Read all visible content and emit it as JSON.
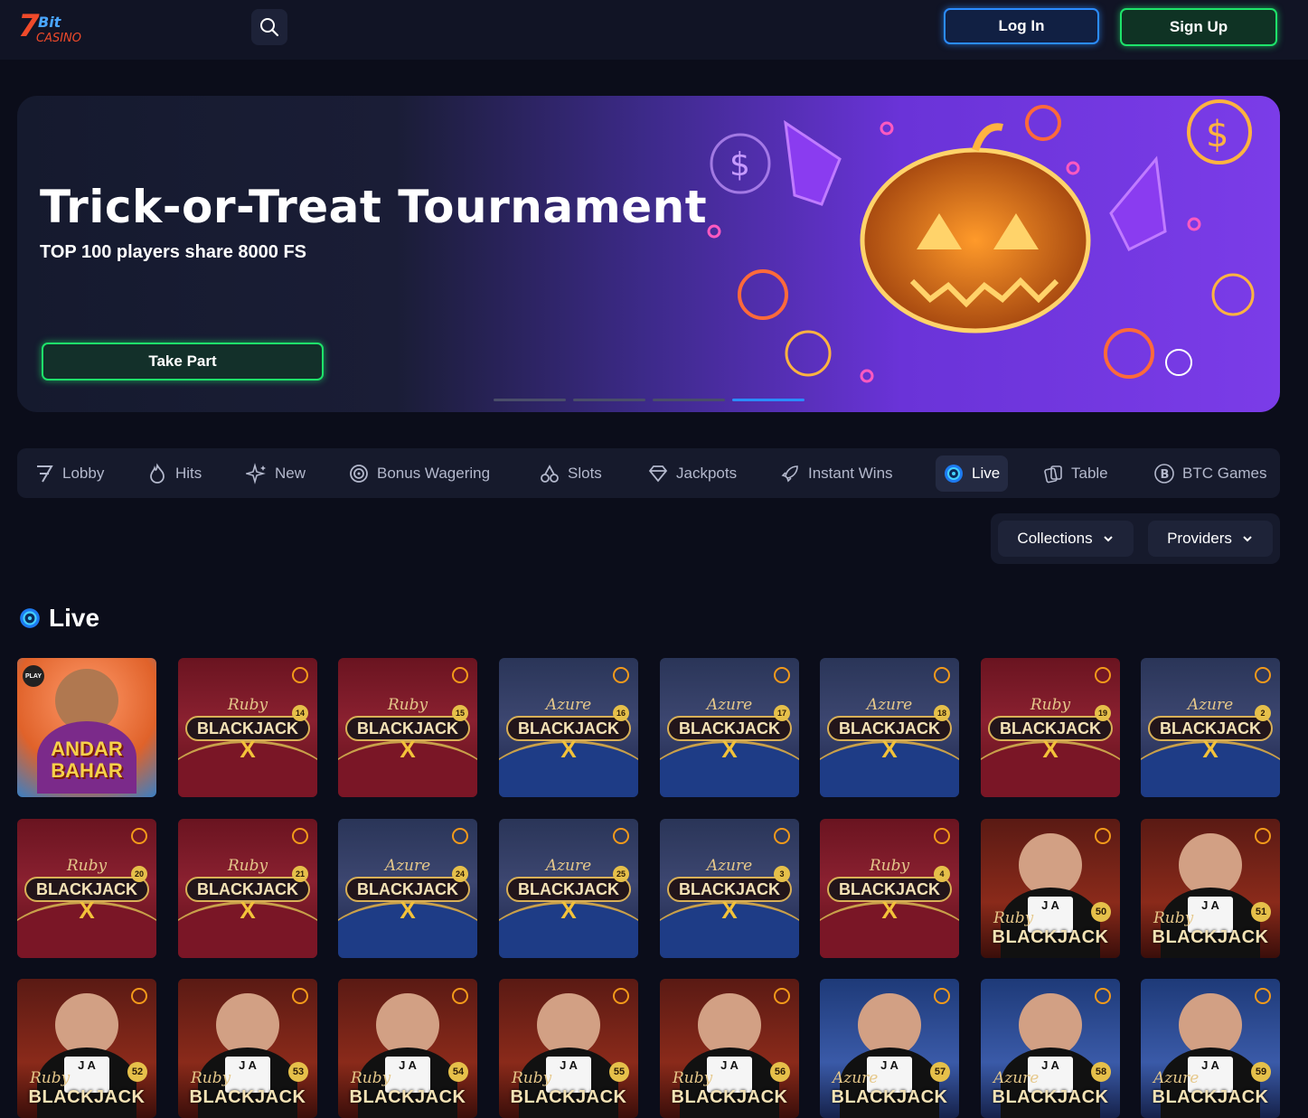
{
  "header": {
    "logo_alt": "7Bit Casino",
    "login_label": "Log In",
    "signup_label": "Sign Up"
  },
  "banner": {
    "title": "Trick-or-Treat Tournament",
    "subtitle": "TOP 100 players share 8000 FS",
    "cta_label": "Take Part",
    "slides": 4,
    "active_slide": 4
  },
  "nav": {
    "items": [
      {
        "label": "Lobby",
        "icon": "seven-icon"
      },
      {
        "label": "Hits",
        "icon": "flame-icon"
      },
      {
        "label": "New",
        "icon": "sparkle-icon"
      },
      {
        "label": "Bonus Wagering",
        "icon": "target-icon"
      },
      {
        "label": "Slots",
        "icon": "cherries-icon"
      },
      {
        "label": "Jackpots",
        "icon": "diamond-icon"
      },
      {
        "label": "Instant Wins",
        "icon": "rocket-icon"
      },
      {
        "label": "Live",
        "icon": "live-chip-icon"
      },
      {
        "label": "Table",
        "icon": "cards-icon"
      },
      {
        "label": "BTC Games",
        "icon": "bitcoin-icon"
      }
    ],
    "active": "Live"
  },
  "filters": {
    "collections_label": "Collections",
    "providers_label": "Providers"
  },
  "section": {
    "title": "Live"
  },
  "games": [
    {
      "kind": "andar",
      "line1": "ANDAR",
      "line2": "BAHAR",
      "badge": "PLAY"
    },
    {
      "kind": "table",
      "theme": "ruby",
      "brand": "Ruby",
      "name": "BLACKJACK",
      "num": "14"
    },
    {
      "kind": "table",
      "theme": "ruby",
      "brand": "Ruby",
      "name": "BLACKJACK",
      "num": "15"
    },
    {
      "kind": "table",
      "theme": "azure",
      "brand": "Azure",
      "name": "BLACKJACK",
      "num": "16"
    },
    {
      "kind": "table",
      "theme": "azure",
      "brand": "Azure",
      "name": "BLACKJACK",
      "num": "17"
    },
    {
      "kind": "table",
      "theme": "azure",
      "brand": "Azure",
      "name": "BLACKJACK",
      "num": "18"
    },
    {
      "kind": "table",
      "theme": "ruby",
      "brand": "Ruby",
      "name": "BLACKJACK",
      "num": "19"
    },
    {
      "kind": "table",
      "theme": "azure",
      "brand": "Azure",
      "name": "BLACKJACK",
      "num": "2"
    },
    {
      "kind": "table",
      "theme": "ruby",
      "brand": "Ruby",
      "name": "BLACKJACK",
      "num": "20"
    },
    {
      "kind": "table",
      "theme": "ruby",
      "brand": "Ruby",
      "name": "BLACKJACK",
      "num": "21"
    },
    {
      "kind": "table",
      "theme": "azure",
      "brand": "Azure",
      "name": "BLACKJACK",
      "num": "24"
    },
    {
      "kind": "table",
      "theme": "azure",
      "brand": "Azure",
      "name": "BLACKJACK",
      "num": "25"
    },
    {
      "kind": "table",
      "theme": "azure",
      "brand": "Azure",
      "name": "BLACKJACK",
      "num": "3"
    },
    {
      "kind": "table",
      "theme": "ruby",
      "brand": "Ruby",
      "name": "BLACKJACK",
      "num": "4"
    },
    {
      "kind": "dealer",
      "theme": "ruby",
      "brand": "Ruby",
      "name": "BLACKJACK",
      "num": "50"
    },
    {
      "kind": "dealer",
      "theme": "ruby",
      "brand": "Ruby",
      "name": "BLACKJACK",
      "num": "51"
    },
    {
      "kind": "dealer",
      "theme": "ruby",
      "brand": "Ruby",
      "name": "BLACKJACK",
      "num": "52"
    },
    {
      "kind": "dealer",
      "theme": "ruby",
      "brand": "Ruby",
      "name": "BLACKJACK",
      "num": "53"
    },
    {
      "kind": "dealer",
      "theme": "ruby",
      "brand": "Ruby",
      "name": "BLACKJACK",
      "num": "54"
    },
    {
      "kind": "dealer",
      "theme": "ruby",
      "brand": "Ruby",
      "name": "BLACKJACK",
      "num": "55"
    },
    {
      "kind": "dealer",
      "theme": "ruby",
      "brand": "Ruby",
      "name": "BLACKJACK",
      "num": "56"
    },
    {
      "kind": "dealer",
      "theme": "azure",
      "brand": "Azure",
      "name": "BLACKJACK",
      "num": "57"
    },
    {
      "kind": "dealer",
      "theme": "azure",
      "brand": "Azure",
      "name": "BLACKJACK",
      "num": "58"
    },
    {
      "kind": "dealer",
      "theme": "azure",
      "brand": "Azure",
      "name": "BLACKJACK",
      "num": "59"
    }
  ],
  "colors": {
    "accent_blue": "#2b8cff",
    "accent_green": "#1ee36a",
    "background": "#0b0d1a"
  }
}
